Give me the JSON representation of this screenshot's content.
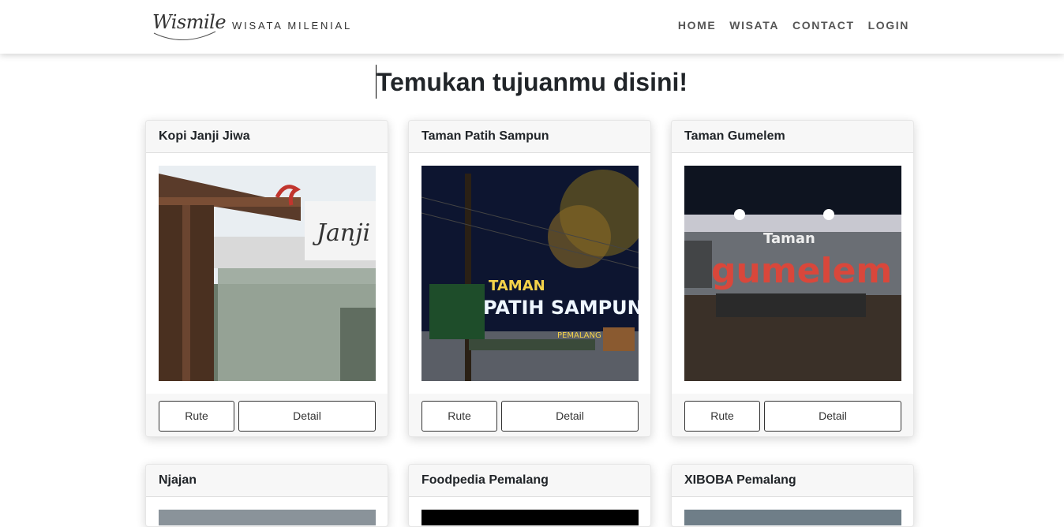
{
  "brand": {
    "logo_text": "Wismile",
    "tagline": "WISATA MILENIAL"
  },
  "nav": {
    "items": [
      "HOME",
      "WISATA",
      "CONTACT",
      "LOGIN"
    ]
  },
  "page": {
    "heading": "Temukan tujuanmu disini!"
  },
  "cards": [
    {
      "title": "Kopi Janji Jiwa",
      "rute_label": "Rute",
      "detail_label": "Detail",
      "image_sign": "Janji"
    },
    {
      "title": "Taman Patih Sampun",
      "rute_label": "Rute",
      "detail_label": "Detail",
      "sign_line1": "TAMAN",
      "sign_line2": "PATIH SAMPUN",
      "sign_line3": "PEMALANG"
    },
    {
      "title": "Taman Gumelem",
      "rute_label": "Rute",
      "detail_label": "Detail",
      "sign_line1": "Taman",
      "sign_line2": "gumelem"
    },
    {
      "title": "Njajan"
    },
    {
      "title": "Foodpedia Pemalang"
    },
    {
      "title": "XIBOBA Pemalang"
    }
  ],
  "colors": {
    "navbar_bg": "#ffffff",
    "card_header_bg": "#f7f7f7",
    "text": "#212529",
    "nav_text": "#555555"
  }
}
